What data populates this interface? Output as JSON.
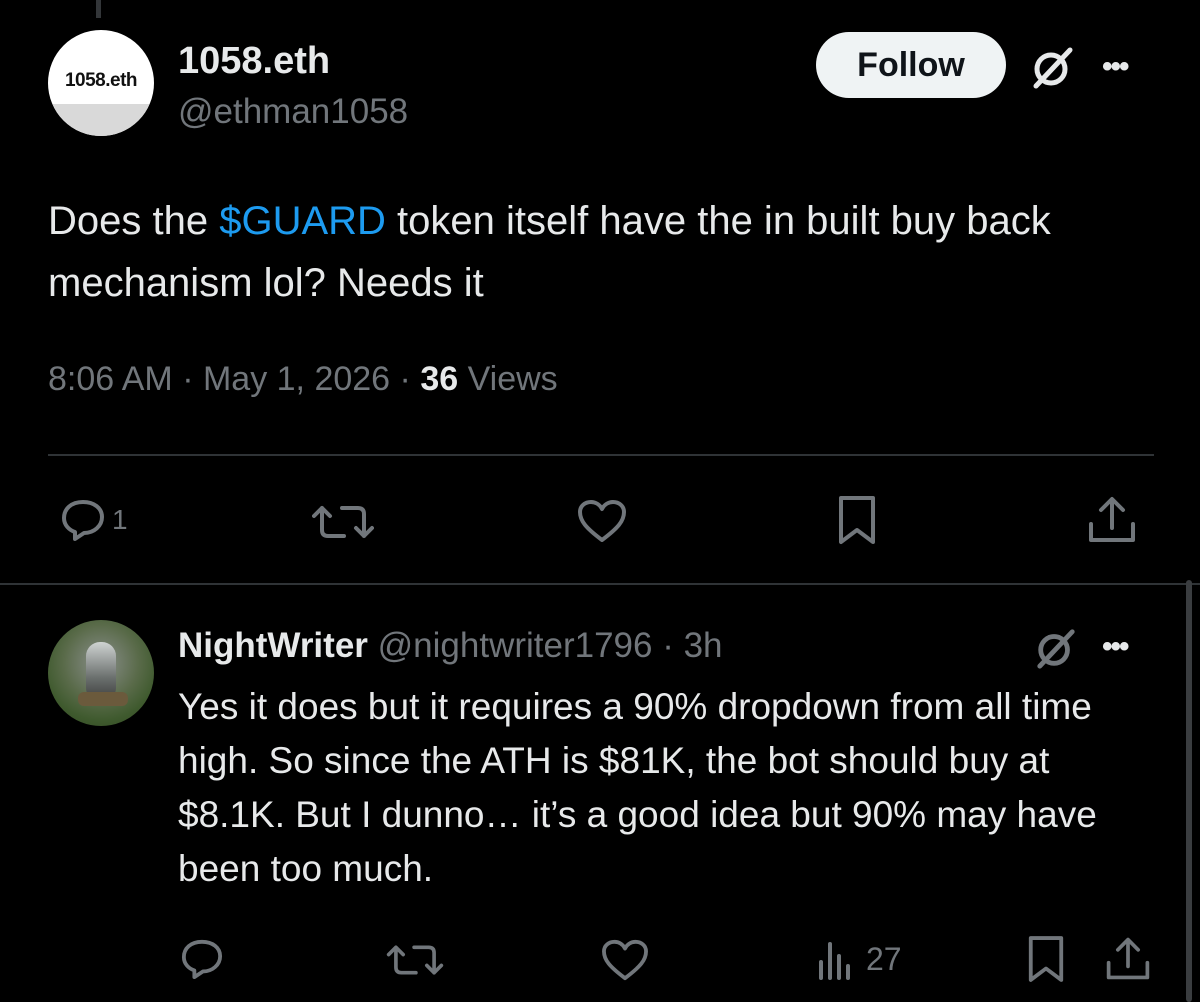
{
  "main_post": {
    "avatar_text": "1058.eth",
    "display_name": "1058.eth",
    "handle": "@ethman1058",
    "follow_label": "Follow",
    "text_before_cashtag": "Does the ",
    "cashtag": "$GUARD",
    "text_after_cashtag": " token itself have the in built buy back mechanism lol? Needs it",
    "time": "8:06 AM",
    "date": "May 1, 2026",
    "views_count": "36",
    "views_label": "Views",
    "separator": " · ",
    "actions": {
      "reply_count": "1"
    }
  },
  "reply_post": {
    "display_name": "NightWriter",
    "handle": "@nightwriter1796",
    "time_ago": "3h",
    "separator": " · ",
    "text": "Yes it does but it requires a 90% dropdown from all time high. So since the ATH is $81K, the bot should buy at $8.1K. But I dunno… it’s a good idea but 90% may have been too much.",
    "actions": {
      "views_count": "27"
    }
  },
  "colors": {
    "background": "#000000",
    "text_primary": "#e7e9ea",
    "text_secondary": "#71767b",
    "link": "#1d9bf0",
    "divider": "#2f3336",
    "follow_bg": "#eff3f4"
  },
  "icons": [
    "grok-icon",
    "more-icon",
    "reply-icon",
    "repost-icon",
    "like-icon",
    "bookmark-icon",
    "share-icon",
    "views-icon"
  ]
}
